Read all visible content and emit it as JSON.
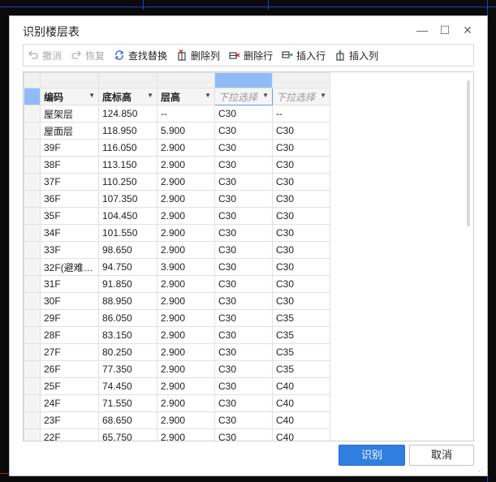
{
  "dialog": {
    "title": "识别楼层表",
    "minimize": "—",
    "maximize": "☐",
    "close": "✕"
  },
  "toolbar": {
    "undo": "撤消",
    "redo": "恢复",
    "find_replace": "查找替换",
    "delete_column": "删除列",
    "delete_row": "删除行",
    "insert_row": "插入行",
    "insert_column": "插入列"
  },
  "table": {
    "headers": [
      "编码",
      "底标高",
      "层高",
      "下拉选择",
      "下拉选择"
    ],
    "rows": [
      [
        "屋架层",
        "124.850",
        "--",
        "C30",
        "--"
      ],
      [
        "屋面层",
        "118.950",
        "5.900",
        "C30",
        "C30"
      ],
      [
        "39F",
        "116.050",
        "2.900",
        "C30",
        "C30"
      ],
      [
        "38F",
        "113.150",
        "2.900",
        "C30",
        "C30"
      ],
      [
        "37F",
        "110.250",
        "2.900",
        "C30",
        "C30"
      ],
      [
        "36F",
        "107.350",
        "2.900",
        "C30",
        "C30"
      ],
      [
        "35F",
        "104.450",
        "2.900",
        "C30",
        "C30"
      ],
      [
        "34F",
        "101.550",
        "2.900",
        "C30",
        "C30"
      ],
      [
        "33F",
        "98.650",
        "2.900",
        "C30",
        "C30"
      ],
      [
        "32F(避难…",
        "94.750",
        "3.900",
        "C30",
        "C30"
      ],
      [
        "31F",
        "91.850",
        "2.900",
        "C30",
        "C30"
      ],
      [
        "30F",
        "88.950",
        "2.900",
        "C30",
        "C30"
      ],
      [
        "29F",
        "86.050",
        "2.900",
        "C30",
        "C35"
      ],
      [
        "28F",
        "83.150",
        "2.900",
        "C30",
        "C35"
      ],
      [
        "27F",
        "80.250",
        "2.900",
        "C30",
        "C35"
      ],
      [
        "26F",
        "77.350",
        "2.900",
        "C30",
        "C35"
      ],
      [
        "25F",
        "74.450",
        "2.900",
        "C30",
        "C40"
      ],
      [
        "24F",
        "71.550",
        "2.900",
        "C30",
        "C40"
      ],
      [
        "23F",
        "68.650",
        "2.900",
        "C30",
        "C40"
      ],
      [
        "22F",
        "65.750",
        "2.900",
        "C30",
        "C40"
      ]
    ]
  },
  "buttons": {
    "recognize": "识别",
    "cancel": "取消"
  },
  "colors": {
    "primary": "#2f7fe0",
    "selection": "#8fbcf5",
    "cad_blue": "#1d3fc9"
  }
}
